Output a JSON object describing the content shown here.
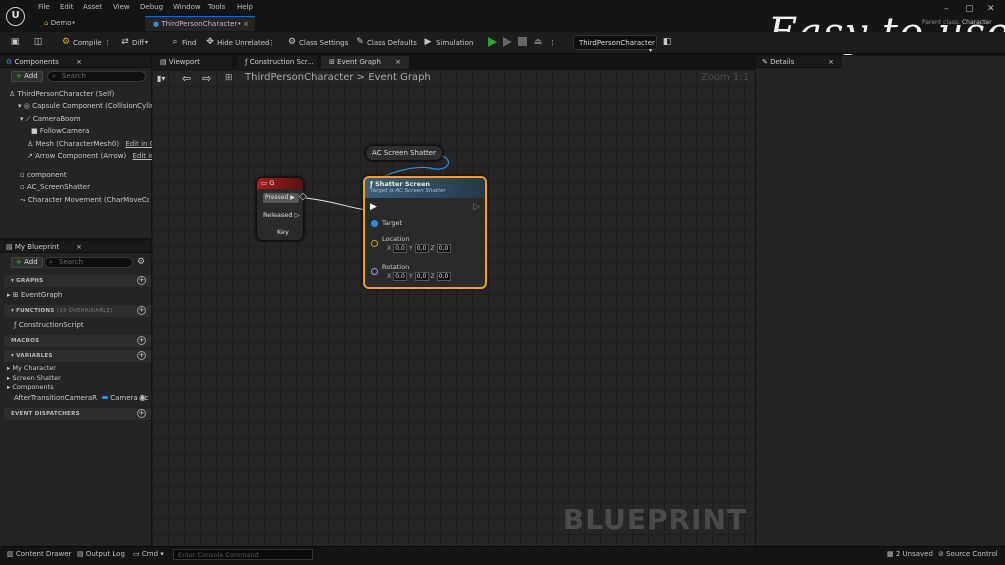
{
  "title_bar": {
    "menus": [
      "File",
      "Edit",
      "Asset",
      "View",
      "Debug",
      "Window",
      "Tools",
      "Help"
    ],
    "doc_tabs": [
      "Demo•",
      "ThirdPersonCharacter•"
    ],
    "watermark": "Easy to use",
    "parent_class_label": "Parent class:",
    "parent_class_value": "Character"
  },
  "toolbar": {
    "compile": "Compile",
    "diff": "Diff",
    "find": "Find",
    "hide_unrelated": "Hide Unrelated",
    "class_settings": "Class Settings",
    "class_defaults": "Class Defaults",
    "simulation": "Simulation",
    "character_select": "ThirdPersonCharacter"
  },
  "components_panel": {
    "title": "Components",
    "add": "Add",
    "search_placeholder": "Search",
    "items": [
      "ThirdPersonCharacter (Self)",
      "Capsule Component (CollisionCylinder)",
      "CameraBoom",
      "FollowCamera",
      "Mesh (CharacterMesh0)",
      "Arrow Component (Arrow)",
      "component",
      "AC_ScreenShatter",
      "Character Movement (CharMoveComp"
    ],
    "edit_in_cpp": "Edit in C++"
  },
  "blueprint_panel": {
    "title": "My Blueprint",
    "add": "Add",
    "search_placeholder": "Search",
    "graphs": "GRAPHS",
    "event_graph": "EventGraph",
    "functions": "FUNCTIONS",
    "functions_count": "(33 OVERRIDABLE)",
    "construction_script": "ConstructionScript",
    "macros": "MACROS",
    "variables": "VARIABLES",
    "variable_groups": [
      "My Character",
      "Screen Shatter",
      "Components"
    ],
    "variable_name": "AfterTransitionCameraR",
    "variable_type": "Camera Actc",
    "event_dispatchers": "EVENT DISPATCHERS"
  },
  "graph_tabs": [
    "Viewport",
    "Construction Scr...",
    "Event Graph"
  ],
  "graph": {
    "breadcrumb_root": "ThirdPersonCharacter",
    "breadcrumb_sep": ">",
    "breadcrumb_leaf": "Event Graph",
    "zoom": "Zoom 1:1",
    "blueprint_watermark": "BLUEPRINT",
    "node_getter": "AC Screen Shatter",
    "node_key": {
      "title": "G",
      "pressed": "Pressed",
      "released": "Released",
      "key": "Key"
    },
    "node_func": {
      "title": "Shatter Screen",
      "subtitle": "Target is AC Screen Shatter",
      "target": "Target",
      "location": "Location",
      "rotation": "Rotation",
      "axis_x": "X",
      "axis_y": "Y",
      "axis_z": "Z",
      "zero": "0,0"
    }
  },
  "details_panel": {
    "title": "Details"
  },
  "status_bar": {
    "content_drawer": "Content Drawer",
    "output_log": "Output Log",
    "cmd": "Cmd",
    "console_placeholder": "Enter Console Command",
    "unsaved": "2 Unsaved",
    "source_control": "Source Control"
  },
  "colors": {
    "accent": "#0070e0",
    "node_select": "#f0a020",
    "key_event_red": "#a81e1e",
    "play_green": "#2ba33b"
  }
}
